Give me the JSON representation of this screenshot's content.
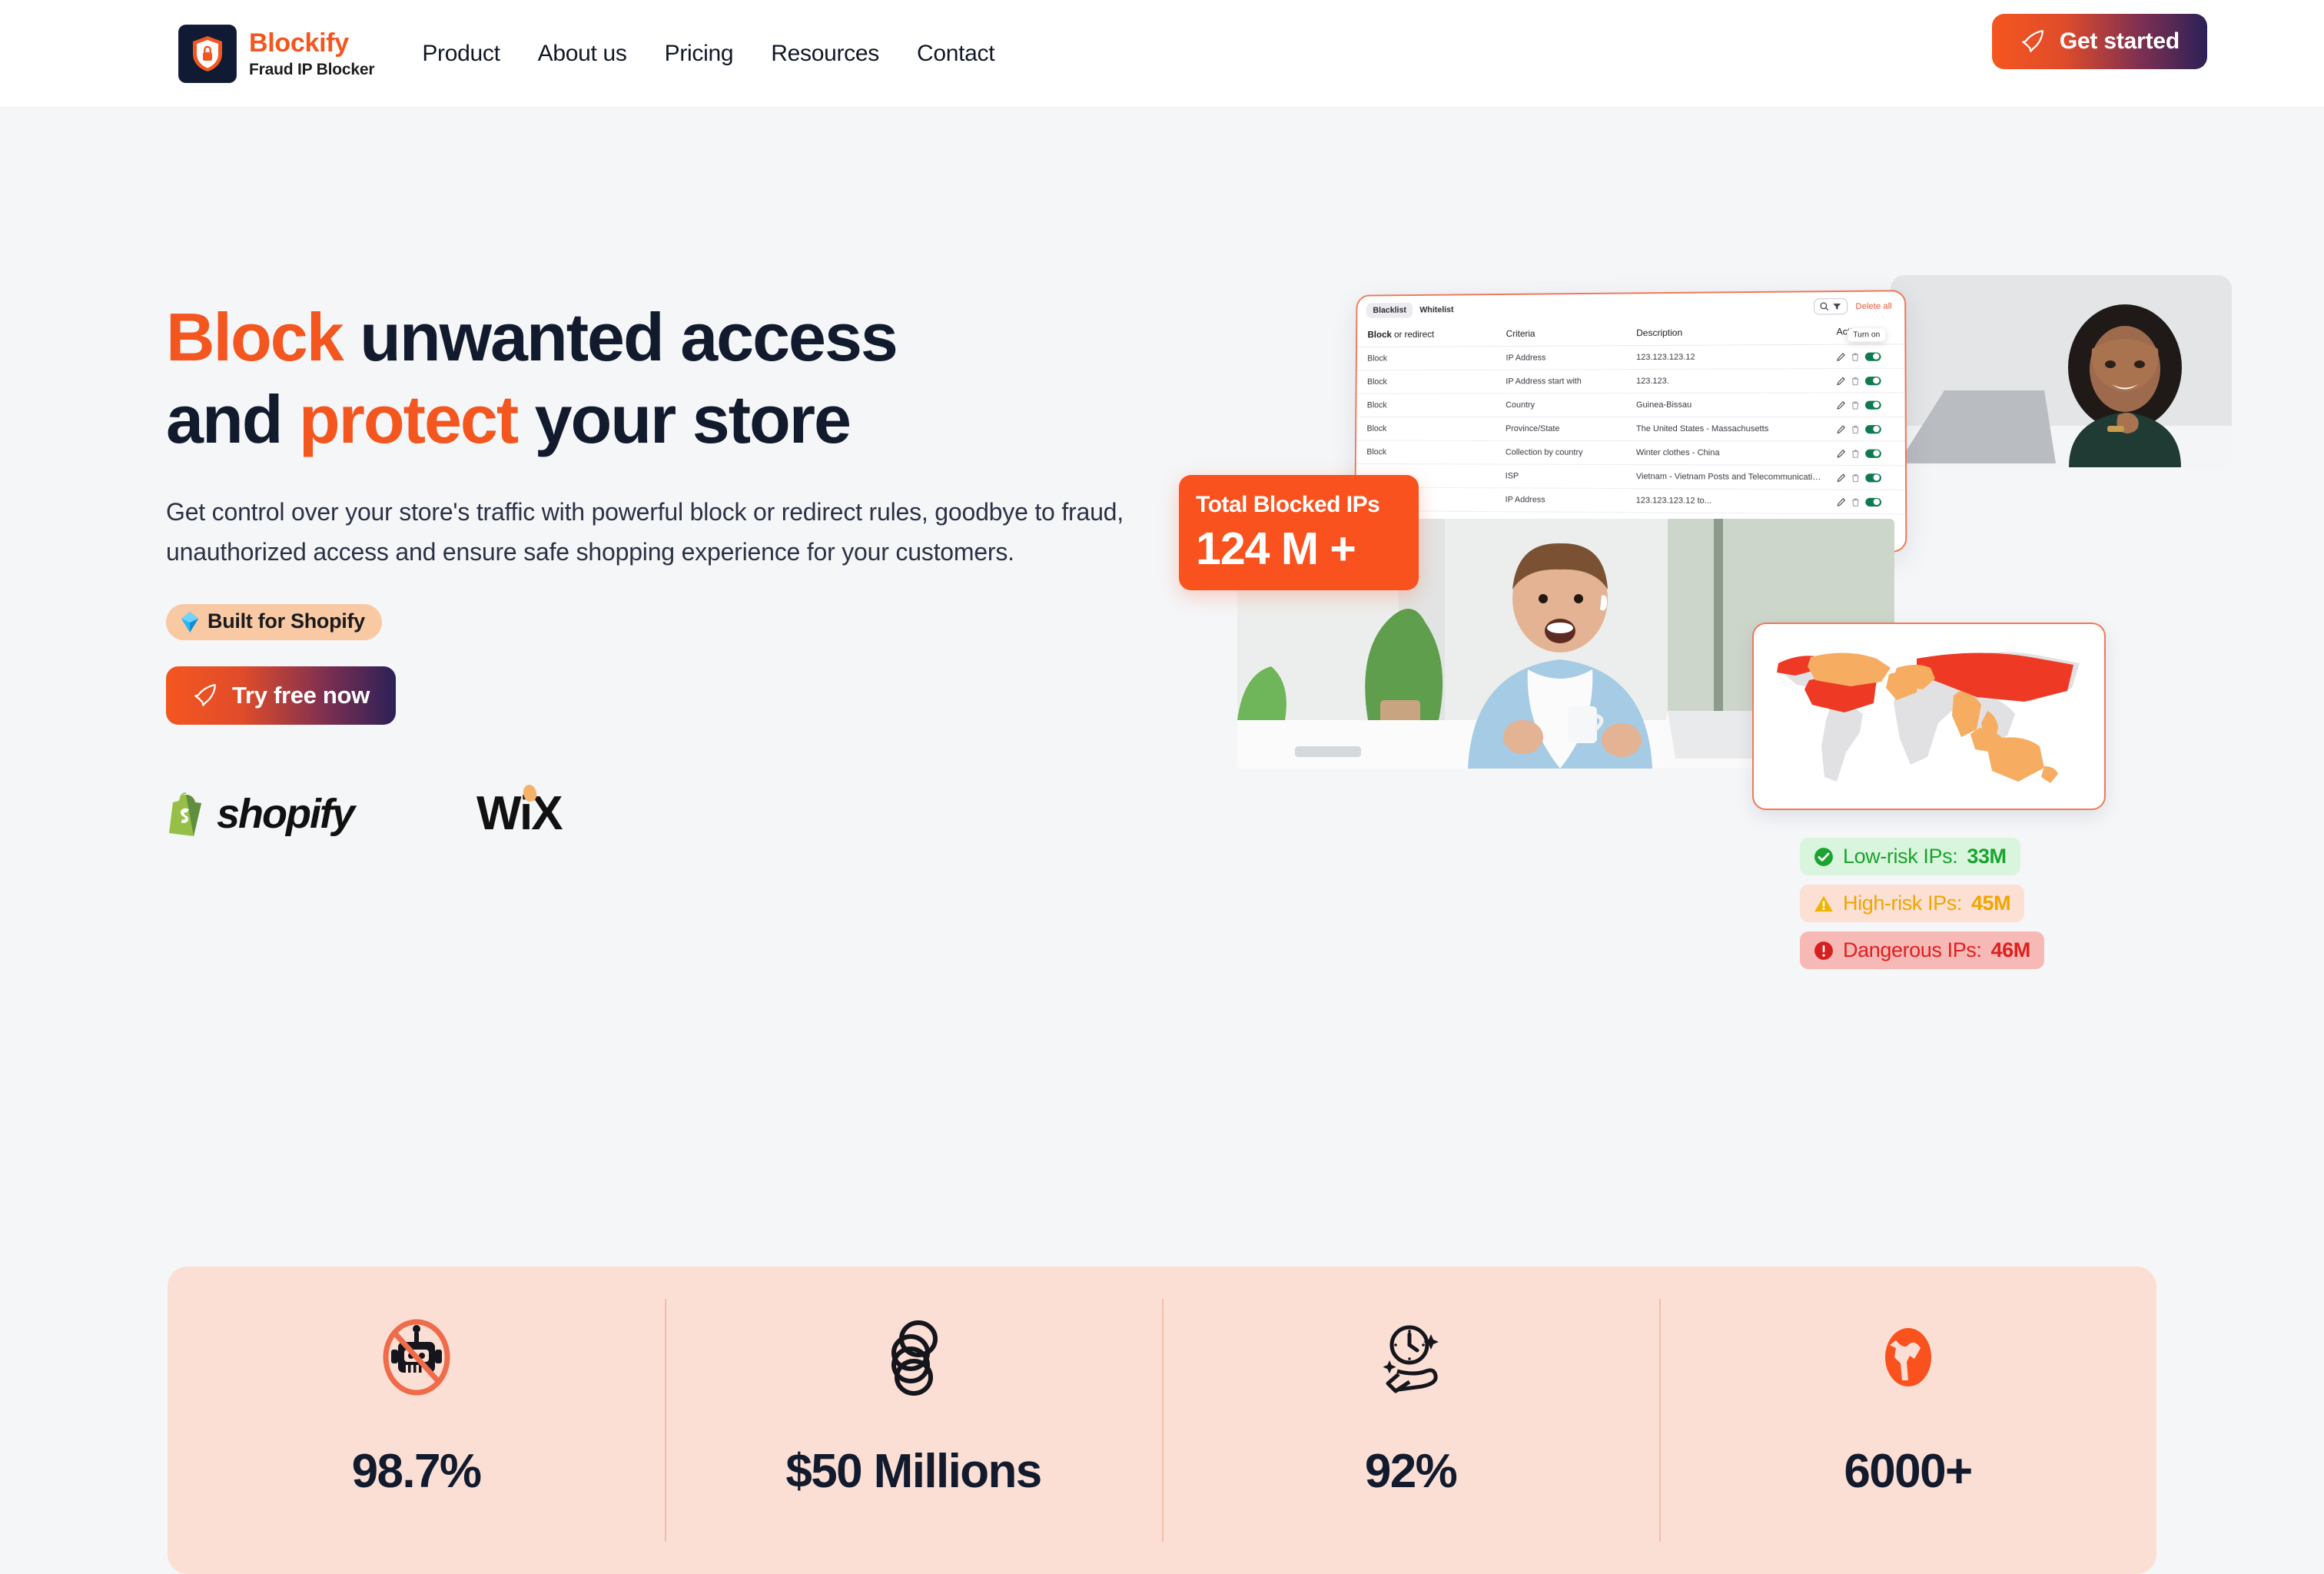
{
  "header": {
    "brand": {
      "name": "Blockify",
      "tagline": "Fraud IP Blocker",
      "logo_icon": "shield-lock-icon"
    },
    "nav": [
      {
        "label": "Product"
      },
      {
        "label": "About us"
      },
      {
        "label": "Pricing"
      },
      {
        "label": "Resources"
      },
      {
        "label": "Contact"
      }
    ],
    "cta": {
      "label": "Get started",
      "icon": "rocket-icon"
    }
  },
  "hero": {
    "title": {
      "line1_highlight": "Block",
      "line1_rest": " unwanted access",
      "line2_pre": "and ",
      "line2_highlight": "protect",
      "line2_rest": " your store"
    },
    "subtitle": "Get control over your store's traffic with powerful block or redirect rules, goodbye to fraud, unauthorized access and ensure safe shopping experience for your customers.",
    "badge": {
      "label": "Built for Shopify",
      "icon": "diamond-icon"
    },
    "cta": {
      "label": "Try free now",
      "icon": "rocket-icon"
    },
    "platforms": [
      {
        "label": "shopify",
        "icon": "shopify-bag-icon"
      },
      {
        "label": "WiX",
        "icon": "wix-logo-icon"
      }
    ]
  },
  "dashboard": {
    "tabs": [
      {
        "label": "Blacklist",
        "active": true
      },
      {
        "label": "Whitelist",
        "active": false
      }
    ],
    "delete_all_label": "Delete all",
    "search_icon": "search-icon",
    "filter_icon": "filter-icon",
    "tooltip": "Turn on",
    "columns": [
      "Block or redirect",
      "Criteria",
      "Description",
      "Action"
    ],
    "columns_bold_prefix": "Block",
    "columns_rest_prefix": " or redirect",
    "rows": [
      {
        "action_type": "Block",
        "criteria": "IP Address",
        "description": "123.123.123.12"
      },
      {
        "action_type": "Block",
        "criteria": "IP Address start with",
        "description": "123.123."
      },
      {
        "action_type": "Block",
        "criteria": "Country",
        "description": "Guinea-Bissau"
      },
      {
        "action_type": "Block",
        "criteria": "Province/State",
        "description": "The United States - Massachusetts"
      },
      {
        "action_type": "Block",
        "criteria": "Collection by country",
        "description": "Winter clothes - China"
      },
      {
        "action_type": "",
        "criteria": "ISP",
        "description": "Vietnam - Vietnam Posts and Telecommunications Group ..."
      },
      {
        "action_type": "",
        "criteria": "IP Address",
        "description": "123.123.123.12 to..."
      }
    ]
  },
  "blocked_card": {
    "title": "Total Blocked IPs",
    "value": "124 M +"
  },
  "risk_badges": [
    {
      "label": "Low-risk IPs: ",
      "value": "33M",
      "icon": "check-circle-icon",
      "style": "low"
    },
    {
      "label": "High-risk IPs: ",
      "value": "45M",
      "icon": "warning-triangle-icon",
      "style": "high"
    },
    {
      "label": "Dangerous IPs: ",
      "value": "46M",
      "icon": "alert-circle-icon",
      "style": "dangerous"
    }
  ],
  "stats": [
    {
      "value": "98.7%",
      "icon": "no-robot-icon"
    },
    {
      "value": "$50 Millions",
      "icon": "coins-stack-icon"
    },
    {
      "value": "92%",
      "icon": "clock-hand-icon"
    },
    {
      "value": "6000+",
      "icon": "globe-icon"
    }
  ],
  "colors": {
    "accent": "#f4561f",
    "orange_card": "#f9521e",
    "dark": "#121b2e",
    "page_bg": "#f5f6f8",
    "stats_bg": "#fbdfd4",
    "badge_bg": "#f9c9a3",
    "low_risk": "#1aa32e",
    "high_risk": "#f0a500",
    "danger": "#e02020",
    "map_red": "#ee3a24",
    "map_orange": "#f6ad62",
    "map_gray": "#e1e1e3"
  }
}
